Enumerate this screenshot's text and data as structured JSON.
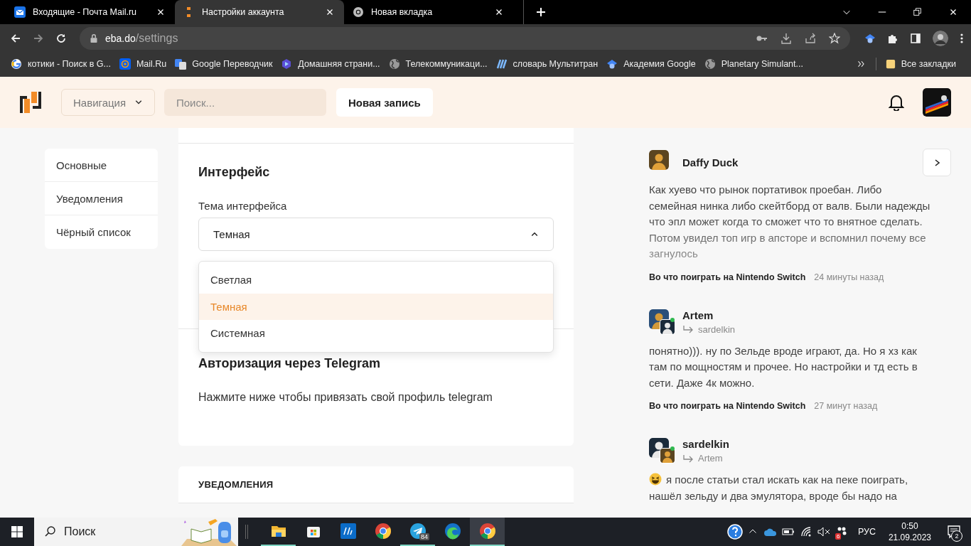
{
  "browser": {
    "tabs": [
      {
        "title": "Входящие - Почта Mail.ru",
        "selected": false,
        "kind": "mail"
      },
      {
        "title": "Настройки аккаунта",
        "selected": true,
        "kind": "site"
      },
      {
        "title": "Новая вкладка",
        "selected": false,
        "kind": "chrome"
      }
    ],
    "url": {
      "host": "eba.do",
      "path": "/settings"
    },
    "bookmarks": [
      {
        "label": "котики - Поиск в G...",
        "kind": "google"
      },
      {
        "label": "Mail.Ru",
        "kind": "mailru"
      },
      {
        "label": "Google Переводчик",
        "kind": "translate"
      },
      {
        "label": "Домашняя страни...",
        "kind": "hex"
      },
      {
        "label": "Телекоммуникаци...",
        "kind": "globe"
      },
      {
        "label": "словарь Мультитран",
        "kind": "multitran"
      },
      {
        "label": "Академия Google",
        "kind": "scholar"
      },
      {
        "label": "Planetary Simulant...",
        "kind": "globe"
      }
    ],
    "all_bookmarks": "Все закладки"
  },
  "site": {
    "nav": "Навигация",
    "search_placeholder": "Поиск...",
    "new_post": "Новая запись"
  },
  "settings_nav": [
    {
      "label": "Основные"
    },
    {
      "label": "Уведомления"
    },
    {
      "label": "Чёрный список"
    }
  ],
  "interface": {
    "title": "Интерфейс",
    "theme_label": "Тема интерфейса",
    "theme": {
      "value": "Темная",
      "expanded": true,
      "options": [
        {
          "label": "Светлая",
          "selected": false
        },
        {
          "label": "Темная",
          "selected": true
        },
        {
          "label": "Системная",
          "selected": false
        }
      ]
    }
  },
  "telegram": {
    "title": "Авторизация через Telegram",
    "text": "Нажмите ниже чтобы привязать свой профиль telegram"
  },
  "notifications": {
    "title": "УВЕДОМЛЕНИЯ"
  },
  "feed": {
    "comments": [
      {
        "author": "Daffy Duck",
        "online": false,
        "emoji": false,
        "faded": true,
        "text": "Как хуево что рынок портативок проебан. Либо семейная нинка либо скейтборд от валв. Были надежды что эпл может когда то сможет что то внятное сделать. Потом увидел топ игр в апсторе и вспомнил почему все загнулось",
        "post": "Во что поиграть на Nintendo Switch",
        "time": "24 минуты назад"
      },
      {
        "author": "Artem",
        "reply_to": "sardelkin",
        "online": true,
        "emoji": false,
        "faded": false,
        "text": "понятно))). ну по Зельде вроде играют, да. Но я хз как там по мощностям и прочее. Но настройки и тд есть в сети. Даже 4к можно.",
        "post": "Во что поиграть на Nintendo Switch",
        "time": "27 минут назад"
      },
      {
        "author": "sardelkin",
        "reply_to": "Artem",
        "online": true,
        "emoji": true,
        "faded": false,
        "text": "я после статьи стал искать как на пеке поиграть, нашёл зельду и два эмулятора, вроде бы надо на"
      }
    ]
  },
  "taskbar": {
    "search_placeholder": "Поиск",
    "apps": [
      {
        "kind": "explorer",
        "running": true,
        "active": false
      },
      {
        "kind": "store",
        "running": false,
        "active": false
      },
      {
        "kind": "hp",
        "running": false,
        "active": false
      },
      {
        "kind": "chrome",
        "running": false,
        "active": false
      },
      {
        "kind": "telegram",
        "running": true,
        "active": false,
        "badge": "84"
      },
      {
        "kind": "edge",
        "running": false,
        "active": false
      },
      {
        "kind": "chrome",
        "running": true,
        "active": true
      }
    ],
    "tray_badge": "6",
    "lang": "РУС",
    "time": "0:50",
    "date": "21.09.2023",
    "notifications": "2"
  }
}
